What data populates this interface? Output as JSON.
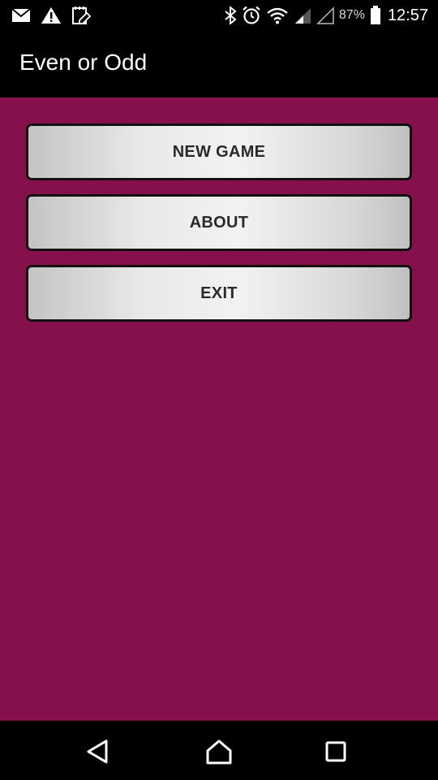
{
  "status_bar": {
    "left_icons": [
      "mail-icon",
      "warning-icon",
      "notepad-icon"
    ],
    "right_icons": [
      "bluetooth-icon",
      "alarm-icon",
      "wifi-icon",
      "signal-icon",
      "signal-empty-icon",
      "battery-icon"
    ],
    "battery_percent": "87%",
    "battery_level": 0.87,
    "time": "12:57"
  },
  "app_bar": {
    "title": "Even or Odd"
  },
  "menu": {
    "new_game_label": "NEW GAME",
    "about_label": "ABOUT",
    "exit_label": "EXIT"
  },
  "nav_bar": {
    "icons": [
      "back-icon",
      "home-icon",
      "recents-icon"
    ]
  },
  "colors": {
    "content_background": "#85104c",
    "bar_background": "#000000",
    "button_border": "#111111",
    "button_text": "#2a2a2a"
  }
}
